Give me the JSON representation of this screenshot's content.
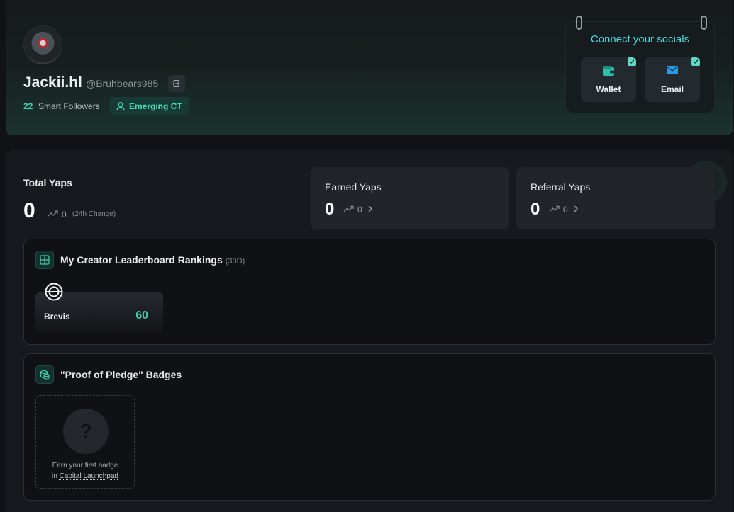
{
  "profile": {
    "display_name": "Jackii.hl",
    "handle": "@Bruhbears985",
    "smart_followers_count": "22",
    "smart_followers_label": "Smart Followers",
    "tier_badge": "Emerging CT"
  },
  "socials": {
    "title": "Connect your socials",
    "items": [
      {
        "label": "Wallet",
        "icon": "wallet-icon"
      },
      {
        "label": "Email",
        "icon": "email-icon"
      }
    ]
  },
  "yaps": {
    "total": {
      "title": "Total Yaps",
      "value": "0",
      "change": "0",
      "change_label": "(24h Change)"
    },
    "earned": {
      "title": "Earned Yaps",
      "value": "0",
      "change": "0"
    },
    "referral": {
      "title": "Referral Yaps",
      "value": "0",
      "change": "0"
    }
  },
  "leaderboard": {
    "title": "My Creator Leaderboard Rankings",
    "period": "(30D)",
    "rankings": [
      {
        "project": "Brevis",
        "score": "60"
      }
    ]
  },
  "badges": {
    "title": "\"Proof of Pledge\" Badges",
    "placeholder_symbol": "?",
    "hint_line1": "Earn your first badge",
    "hint_line2_prefix": "in ",
    "hint_link": "Capital Launchpad"
  },
  "colors": {
    "accent": "#3fd1b2",
    "socials_title": "#4ed8e0",
    "background": "#101215"
  }
}
